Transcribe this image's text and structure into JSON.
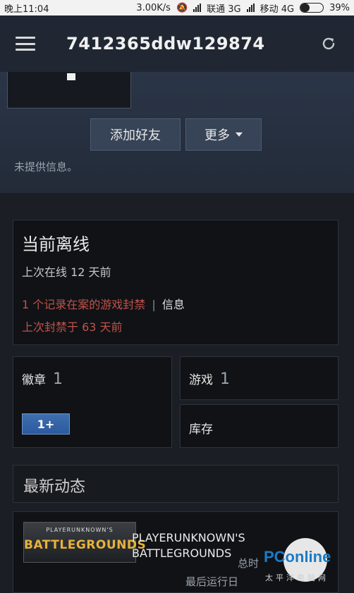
{
  "status_bar": {
    "time": "晚上11:04",
    "net_speed": "3.00K/s",
    "carrier1": "联通 3G",
    "carrier2": "移动 4G",
    "battery": "39%",
    "battery_level": 0.39
  },
  "header": {
    "title": "7412365ddw129874",
    "menu_icon": "hamburger-icon",
    "refresh_icon": "refresh-icon"
  },
  "profile": {
    "add_friend": "添加好友",
    "more": "更多",
    "no_info": "未提供信息。"
  },
  "status": {
    "title": "当前离线",
    "last_online": "上次在线 12 天前",
    "ban_record": "1 个记录在案的游戏封禁",
    "separator": "|",
    "info_link": "信息",
    "last_ban": "上次封禁于 63 天前"
  },
  "tiles": {
    "badges_label": "徽章",
    "badges_count": "1",
    "badge_icon_text": "1+",
    "games_label": "游戏",
    "games_count": "1",
    "inventory_label": "库存"
  },
  "activity": {
    "title": "最新动态",
    "game": {
      "art_small": "PLAYERUNKNOWN'S",
      "art_big": "BATTLEGROUNDS",
      "name_line1": "PLAYERUNKNOWN'S",
      "name_line2": "BATTLEGROUNDS",
      "total_time": "总时",
      "last_run": "最后运行日"
    }
  },
  "watermark": {
    "logo": "PConline",
    "sub": "太平洋电脑网"
  },
  "colors": {
    "header_bg": "#202733",
    "ban_red": "#c1524a",
    "page_bg": "#1b1f25"
  }
}
